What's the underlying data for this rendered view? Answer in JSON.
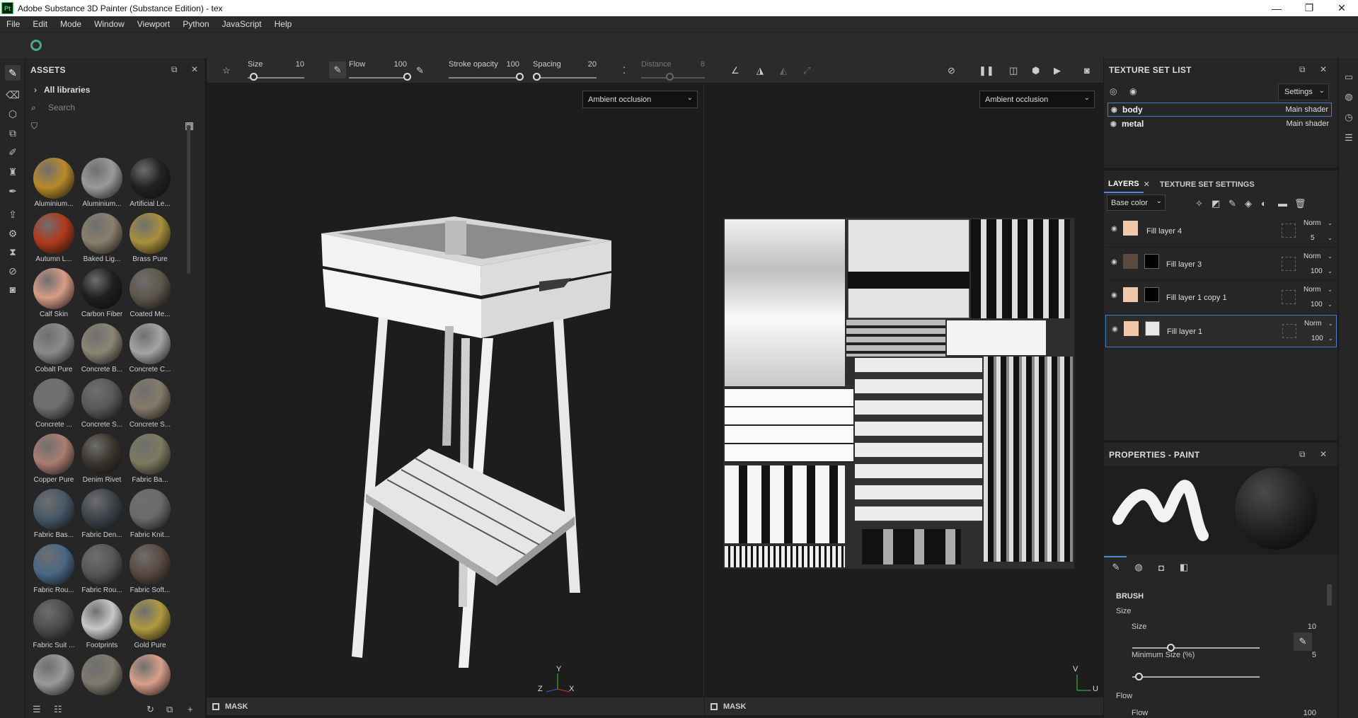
{
  "window": {
    "app_badge": "Pt",
    "title": "Adobe Substance 3D Painter (Substance Edition) - tex"
  },
  "menu": [
    "File",
    "Edit",
    "Mode",
    "Window",
    "Viewport",
    "Python",
    "JavaScript",
    "Help"
  ],
  "assets": {
    "title": "ASSETS",
    "library": "All libraries",
    "search_placeholder": "Search",
    "items": [
      {
        "name": "Aluminium...",
        "color": "#b88a2a"
      },
      {
        "name": "Aluminium...",
        "color": "#9a9a9a"
      },
      {
        "name": "Artificial Le...",
        "color": "#222222"
      },
      {
        "name": "Autumn L...",
        "color": "#b03a1c"
      },
      {
        "name": "Baked Lig...",
        "color": "#8a7f6c"
      },
      {
        "name": "Brass Pure",
        "color": "#a88f3a"
      },
      {
        "name": "Calf Skin",
        "color": "#d79c85"
      },
      {
        "name": "Carbon Fiber",
        "color": "#1f1f1f"
      },
      {
        "name": "Coated Me...",
        "color": "#5e574a"
      },
      {
        "name": "Cobalt Pure",
        "color": "#8a8a8a"
      },
      {
        "name": "Concrete B...",
        "color": "#8c8575"
      },
      {
        "name": "Concrete C...",
        "color": "#a4a4a4"
      },
      {
        "name": "Concrete ...",
        "color": "#6f6f6f"
      },
      {
        "name": "Concrete S...",
        "color": "#5a5a5a"
      },
      {
        "name": "Concrete S...",
        "color": "#857a6a"
      },
      {
        "name": "Copper Pure",
        "color": "#a97e70"
      },
      {
        "name": "Denim Rivet",
        "color": "#3b342c"
      },
      {
        "name": "Fabric Ba...",
        "color": "#7c7a60"
      },
      {
        "name": "Fabric Bas...",
        "color": "#475868"
      },
      {
        "name": "Fabric Den...",
        "color": "#3e434a"
      },
      {
        "name": "Fabric Knit...",
        "color": "#6a6a6a"
      },
      {
        "name": "Fabric Rou...",
        "color": "#4a6885"
      },
      {
        "name": "Fabric Rou...",
        "color": "#575757"
      },
      {
        "name": "Fabric Soft...",
        "color": "#5a4a42"
      },
      {
        "name": "Fabric Suit ...",
        "color": "#4d4d4d"
      },
      {
        "name": "Footprints",
        "color": "#c8c8c8"
      },
      {
        "name": "Gold Pure",
        "color": "#b09a3e"
      },
      {
        "name": "",
        "color": "#9a9a9a"
      },
      {
        "name": "",
        "color": "#7e7a6e"
      },
      {
        "name": "",
        "color": "#d8a08a"
      }
    ]
  },
  "toolbar": {
    "size_label": "Size",
    "size_value": "10",
    "size_level": 0.1,
    "flow_label": "Flow",
    "flow_value": "100",
    "flow_level": 1.0,
    "stroke_opacity_label": "Stroke opacity",
    "stroke_opacity_value": "100",
    "stroke_opacity_level": 1.0,
    "spacing_label": "Spacing",
    "spacing_value": "20",
    "spacing_level": 0.05,
    "distance_label": "Distance",
    "distance_value": "8"
  },
  "viewport3d": {
    "channel": "Ambient occlusion",
    "mask_label": "MASK",
    "axis_x": "X",
    "axis_y": "Y",
    "axis_z": "Z"
  },
  "viewport2d": {
    "channel": "Ambient occlusion",
    "mask_label": "MASK",
    "axis_v": "V",
    "axis_u": "U"
  },
  "texture_set_list": {
    "title": "TEXTURE SET LIST",
    "settings_label": "Settings",
    "sets": [
      {
        "name": "body",
        "shader": "Main shader",
        "selected": true
      },
      {
        "name": "metal",
        "shader": "Main shader",
        "selected": false
      }
    ]
  },
  "layers_panel": {
    "tab_layers": "LAYERS",
    "tab_texture_settings": "TEXTURE SET SETTINGS",
    "channel": "Base color",
    "layers": [
      {
        "name": "Fill layer 4",
        "blend": "Norm",
        "opacity": "5",
        "color": "#f0c8a8",
        "mask": "none",
        "selected": false
      },
      {
        "name": "Fill layer 3",
        "blend": "Norm",
        "opacity": "100",
        "color": "#5a4a3e",
        "mask": "#000000",
        "selected": false
      },
      {
        "name": "Fill layer 1 copy 1",
        "blend": "Norm",
        "opacity": "100",
        "color": "#f0c8a8",
        "mask": "#000000",
        "selected": false
      },
      {
        "name": "Fill layer 1",
        "blend": "Norm",
        "opacity": "100",
        "color": "#f0c8a8",
        "mask": "#e8e8e8",
        "selected": true
      }
    ]
  },
  "properties": {
    "title": "PROPERTIES - PAINT",
    "section": "BRUSH",
    "size_group": "Size",
    "size_label": "Size",
    "size_value": "10",
    "size_level": 0.3,
    "min_size_label": "Minimum Size (%)",
    "min_size_value": "5",
    "min_size_level": 0.05,
    "flow_group": "Flow",
    "flow_label": "Flow",
    "flow_value": "100"
  }
}
